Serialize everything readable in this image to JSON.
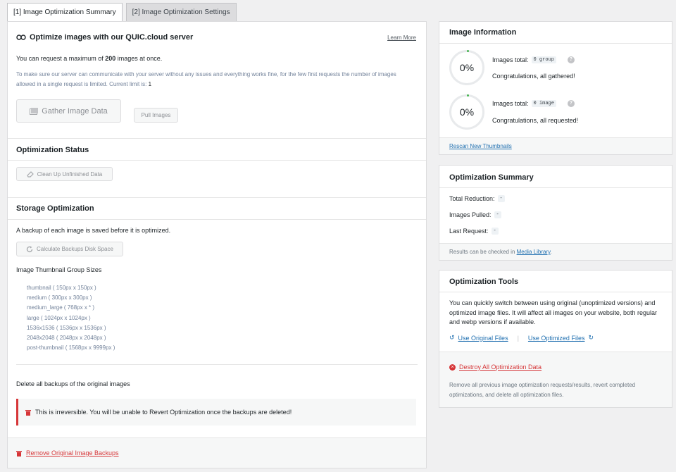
{
  "tabs": [
    {
      "label": "[1] Image Optimization Summary"
    },
    {
      "label": "[2] Image Optimization Settings"
    }
  ],
  "optimize": {
    "title": "Optimize images with our QUIC.cloud server",
    "learn_more": "Learn More",
    "max_prefix": "You can request a maximum of ",
    "max_count": "200",
    "max_suffix": " images at once.",
    "limit_note": "To make sure our server can communicate with your server without any issues and everything works fine, for the few first requests the number of images allowed in a single request is limited. Current limit is: ",
    "limit_value": "1",
    "gather_button": "Gather Image Data",
    "pull_button": "Pull Images"
  },
  "status": {
    "title": "Optimization Status",
    "cleanup_button": "Clean Up Unfinished Data"
  },
  "storage": {
    "title": "Storage Optimization",
    "backup_note": "A backup of each image is saved before it is optimized.",
    "calc_button": "Calculate Backups Disk Space",
    "sizes_title": "Image Thumbnail Group Sizes",
    "sizes": [
      "thumbnail ( 150px x 150px )",
      "medium ( 300px x 300px )",
      "medium_large ( 768px x * )",
      "large ( 1024px x 1024px )",
      "1536x1536 ( 1536px x 1536px )",
      "2048x2048 ( 2048px x 2048px )",
      "post-thumbnail ( 1568px x 9999px )"
    ],
    "delete_title": "Delete all backups of the original images",
    "warning": "This is irreversible. You will be unable to Revert Optimization once the backups are deleted!",
    "remove_link": "Remove Original Image Backups"
  },
  "image_info": {
    "title": "Image Information",
    "rows": [
      {
        "percent": "0%",
        "label": "Images total:",
        "code": "0 group",
        "note": "Congratulations, all gathered!"
      },
      {
        "percent": "0%",
        "label": "Images total:",
        "code": "0 image",
        "note": "Congratulations, all requested!"
      }
    ],
    "rescan_link": "Rescan New Thumbnails"
  },
  "summary": {
    "title": "Optimization Summary",
    "rows": [
      {
        "label": "Total Reduction:",
        "value": "-"
      },
      {
        "label": "Images Pulled:",
        "value": "-"
      },
      {
        "label": "Last Request:",
        "value": "-"
      }
    ],
    "foot_prefix": "Results can be checked in ",
    "foot_link": "Media Library",
    "foot_suffix": "."
  },
  "tools": {
    "title": "Optimization Tools",
    "desc": "You can quickly switch between using original (unoptimized versions) and optimized image files. It will affect all images on your website, both regular and webp versions if available.",
    "use_original": "Use Original Files",
    "separator": "|",
    "use_optimized": "Use Optimized Files",
    "destroy_link": "Destroy All Optimization Data",
    "destroy_desc": "Remove all previous image optimization requests/results, revert completed optimizations, and delete all optimization files."
  }
}
